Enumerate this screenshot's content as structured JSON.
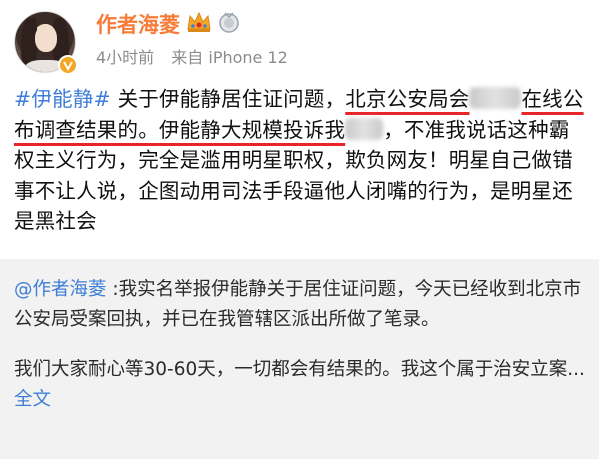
{
  "header": {
    "author_name": "作者海菱",
    "time": "4小时前",
    "source": "来自 iPhone 12",
    "crown_icon": "crown-icon",
    "medal_icon": "medal-icon",
    "verify_icon": "v-badge-icon"
  },
  "post": {
    "hashtag": "#伊能静#",
    "seg1": " 关于伊能静居住证问题，",
    "seg2a": "北京公安局会",
    "seg2b": "在线公布调查结果的。",
    "seg3a": "伊能静大规模投诉我",
    "seg3b": "，不准我说话这种霸权主义行为，完全是滥用明星职权，欺负网友！明星自己做错事不让人说，企图动用司法手段逼他人闭嘴的行为，是明星还是黑社会"
  },
  "repost": {
    "mention": "@作者海菱",
    "para1": " :我实名举报伊能静关于居住证问题，今天已经收到北京市公安局受案回执，并已在我管辖区派出所做了笔录。",
    "para2": "我们大家耐心等30-60天，一切都会有结果的。我这个属于治安立案...",
    "more_label": " 全文"
  },
  "colors": {
    "author": "#f77c3a",
    "link": "#3f7ed8",
    "underline": "#e8262a",
    "repost_bg": "#f2f2f2",
    "meta": "#8c8c8c"
  }
}
